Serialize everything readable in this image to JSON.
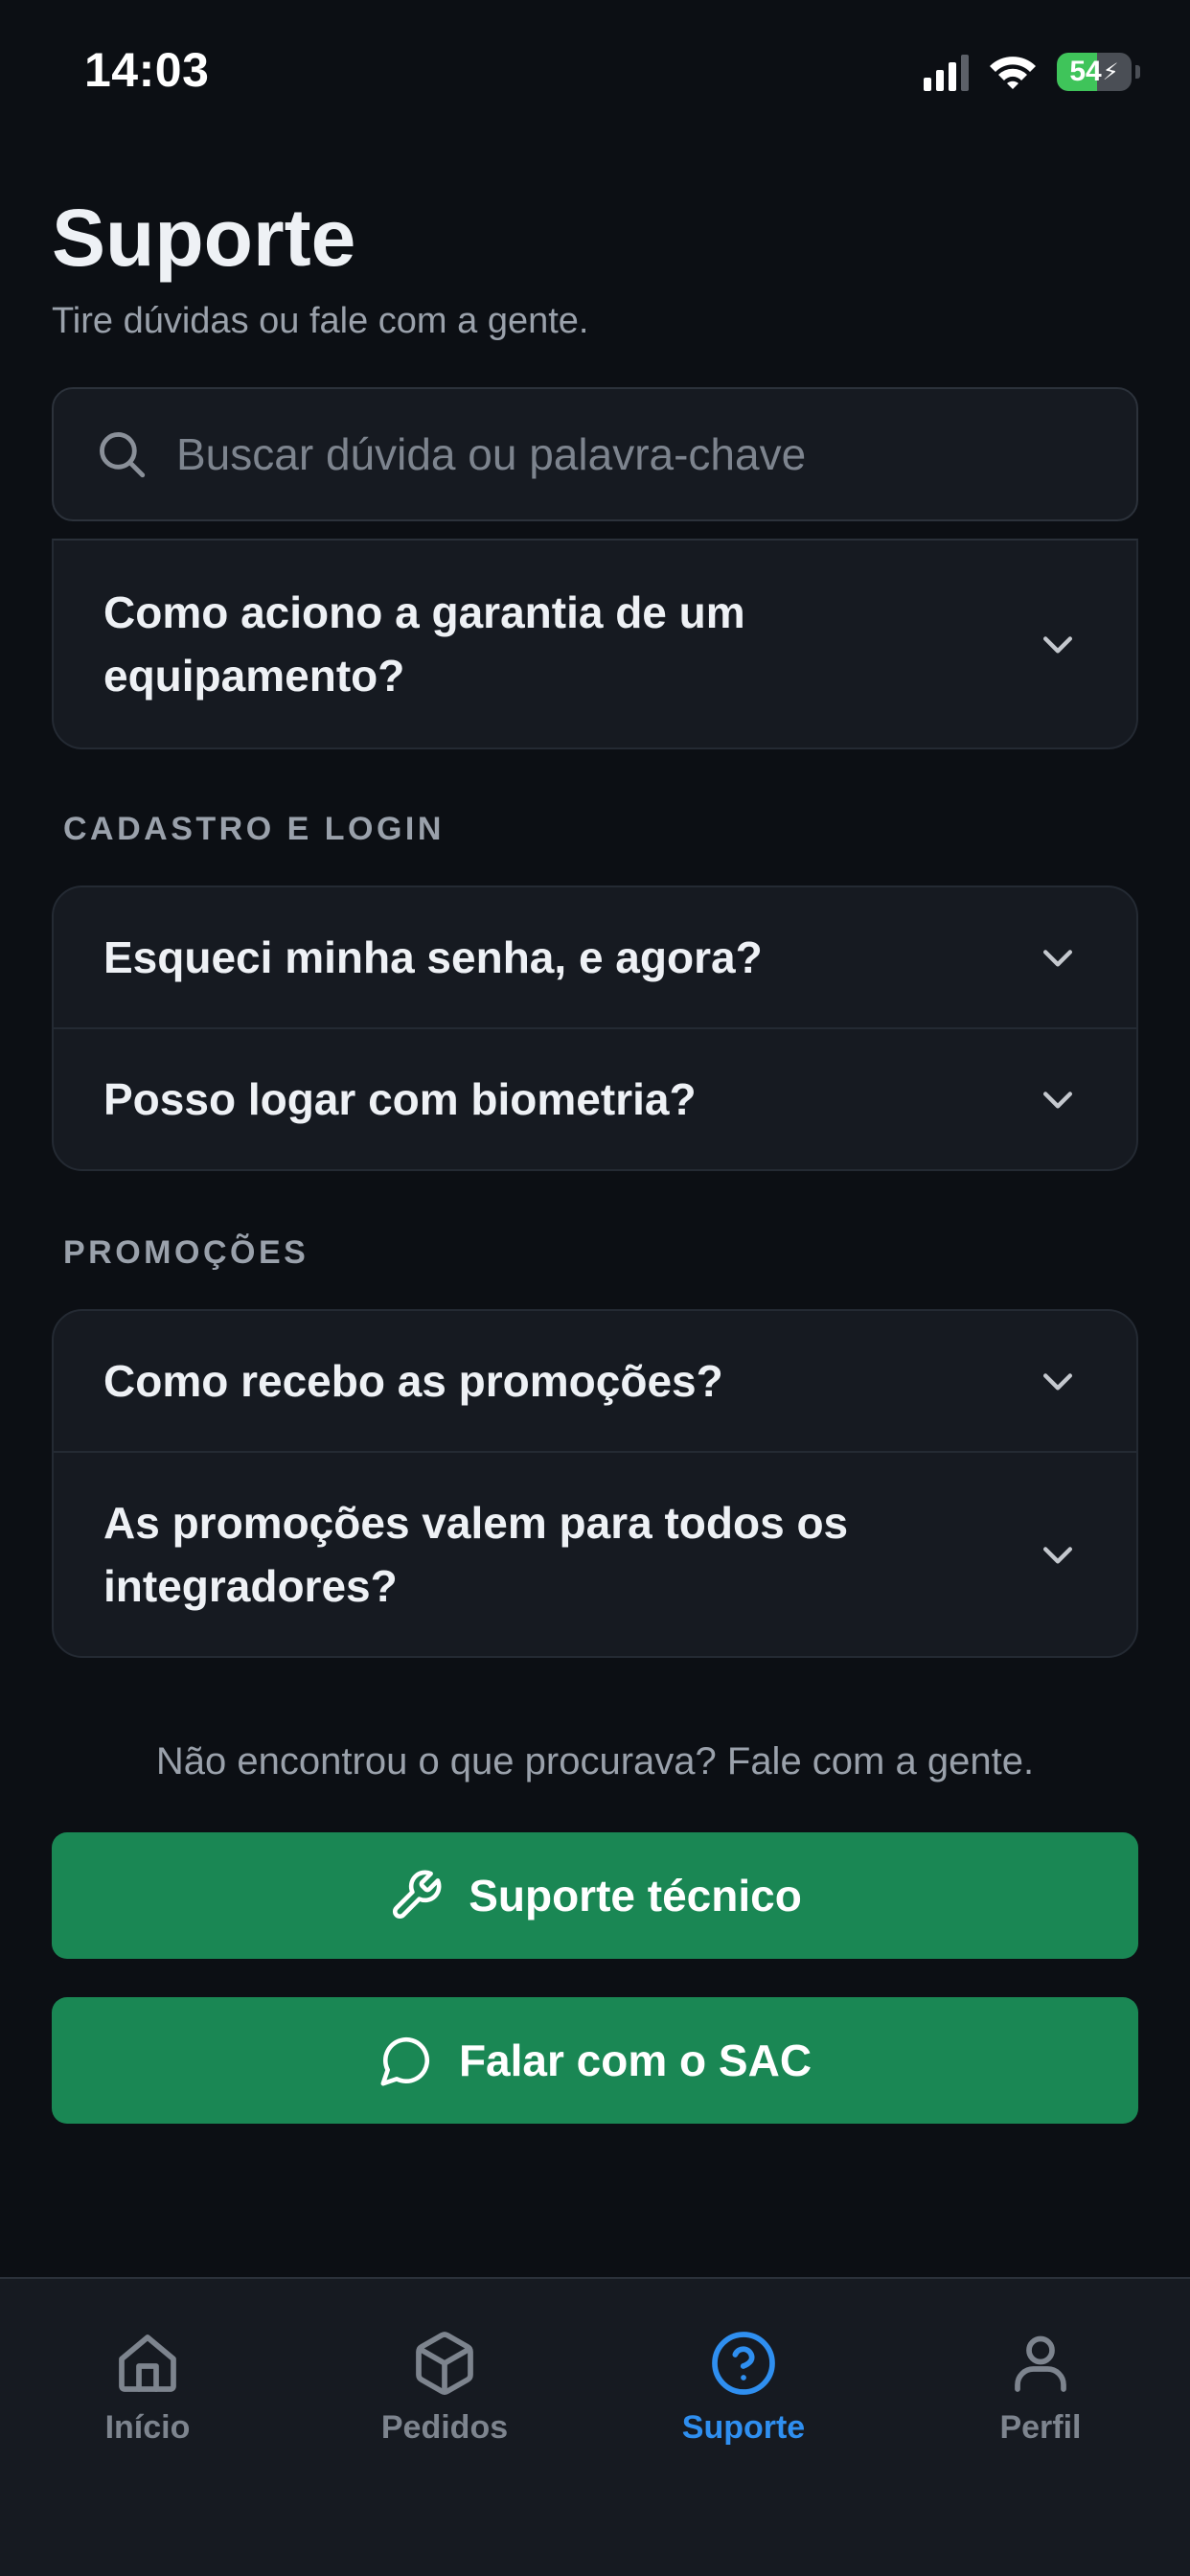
{
  "status_bar": {
    "time": "14:03",
    "battery": "54",
    "battery_level": 0.54
  },
  "header": {
    "title": "Suporte",
    "subtitle": "Tire dúvidas ou fale com a gente."
  },
  "search": {
    "placeholder": "Buscar dúvida ou palavra-chave",
    "value": ""
  },
  "faq": {
    "partial_group": {
      "items": [
        {
          "question": "Como aciono a garantia de um equipamento?"
        }
      ]
    },
    "sections": [
      {
        "title": "CADASTRO E LOGIN",
        "items": [
          {
            "question": "Esqueci minha senha, e agora?"
          },
          {
            "question": "Posso logar com biometria?"
          }
        ]
      },
      {
        "title": "PROMOÇÕES",
        "items": [
          {
            "question": "Como recebo as promoções?"
          },
          {
            "question": "As promoções valem para todos os integradores?"
          }
        ]
      }
    ]
  },
  "help": {
    "prompt": "Não encontrou o que procurava? Fale com a gente.",
    "tech_support_label": "Suporte técnico",
    "sac_label": "Falar com o SAC"
  },
  "tabs": [
    {
      "label": "Início",
      "icon": "home-icon",
      "active": false
    },
    {
      "label": "Pedidos",
      "icon": "package-icon",
      "active": false
    },
    {
      "label": "Suporte",
      "icon": "help-circle-icon",
      "active": true
    },
    {
      "label": "Perfil",
      "icon": "user-icon",
      "active": false
    }
  ],
  "colors": {
    "background": "#0c0f14",
    "card": "#161a21",
    "accent_green": "#1a8754",
    "active_tab": "#2f8ff0",
    "muted_text": "#9aa1ab"
  }
}
